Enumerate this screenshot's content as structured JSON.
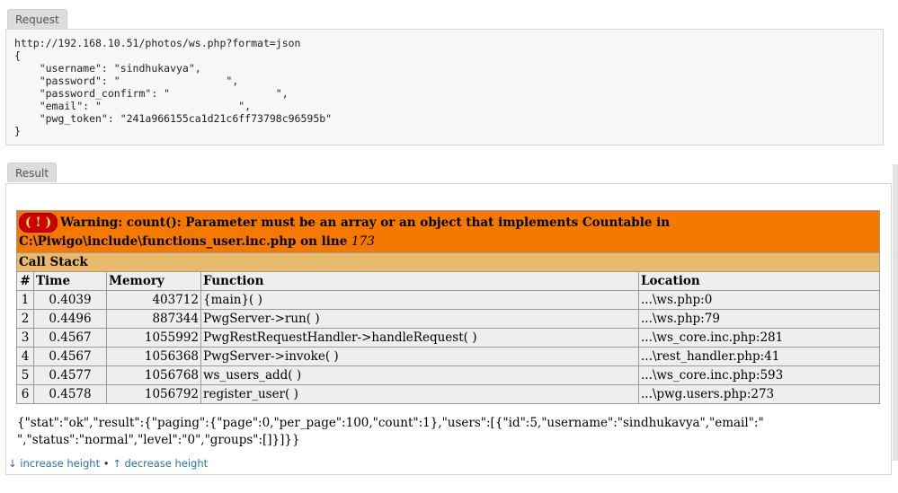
{
  "request": {
    "tab_label": "Request",
    "body": "http://192.168.10.51/photos/ws.php?format=json\n{\n    \"username\": \"sindhukavya\",\n    \"password\": \"                 \",\n    \"password_confirm\": \"                 \",\n    \"email\": \"                      \",\n    \"pwg_token\": \"241a966155ca1d21c6ff73798c96595b\"\n}"
  },
  "result": {
    "tab_label": "Result",
    "warning": {
      "icon": "( ! )",
      "text": "Warning: count(): Parameter must be an array or an object that implements Countable in C:\\Piwigo\\include\\functions_user.inc.php on line ",
      "line": "173"
    },
    "call_stack": {
      "title": "Call Stack",
      "headers": [
        "#",
        "Time",
        "Memory",
        "Function",
        "Location"
      ],
      "rows": [
        [
          "1",
          "0.4039",
          "403712",
          "{main}( )",
          "...\\ws.php:0"
        ],
        [
          "2",
          "0.4496",
          "887344",
          "PwgServer->run( )",
          "...\\ws.php:79"
        ],
        [
          "3",
          "0.4567",
          "1055992",
          "PwgRestRequestHandler->handleRequest( )",
          "...\\ws_core.inc.php:281"
        ],
        [
          "4",
          "0.4567",
          "1056368",
          "PwgServer->invoke( )",
          "...\\rest_handler.php:41"
        ],
        [
          "5",
          "0.4577",
          "1056768",
          "ws_users_add( )",
          "...\\ws_core.inc.php:593"
        ],
        [
          "6",
          "0.4578",
          "1056792",
          "register_user( )",
          "...\\pwg.users.php:273"
        ]
      ]
    },
    "json_output": "{\"stat\":\"ok\",\"result\":{\"paging\":{\"page\":0,\"per_page\":100,\"count\":1},\"users\":[{\"id\":5,\"username\":\"sindhukavya\",\"email\":\"                                              \",\"status\":\"normal\",\"level\":\"0\",\"groups\":[]}]}}"
  },
  "footer": {
    "increase_label": "↓ increase height",
    "separator": "•",
    "decrease_label": "↑ decrease height"
  }
}
